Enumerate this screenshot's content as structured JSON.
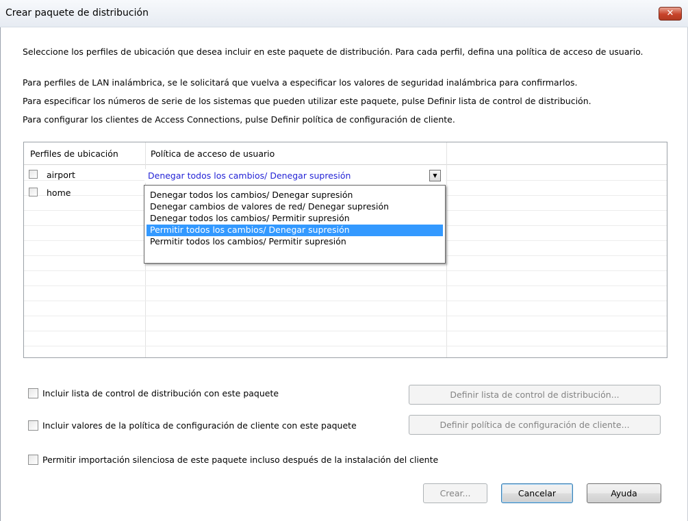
{
  "window": {
    "title": "Crear paquete de distribución",
    "close_glyph": "✕"
  },
  "description": {
    "line1": "Seleccione los perfiles de ubicación que desea incluir en este paquete de distribución. Para cada perfil, defina una política de acceso de usuario.",
    "line2": "Para perfiles de LAN inalámbrica, se le solicitará que vuelva a especificar los valores de seguridad inalámbrica para confirmarlos.",
    "line3": "Para especificar los números de serie de los sistemas que pueden utilizar este paquete, pulse Definir lista de control de distribución.",
    "line4": "Para configurar los clientes de Access Connections, pulse Definir política de configuración de cliente."
  },
  "table": {
    "columns": [
      "Perfiles de ubicación",
      "Política de acceso de usuario"
    ],
    "rows": [
      {
        "name": "airport",
        "checked": false,
        "policy": "Denegar todos los cambios/ Denegar supresión"
      },
      {
        "name": "home",
        "checked": false,
        "policy": ""
      }
    ]
  },
  "policy_dropdown": {
    "selected_value": "Denegar todos los cambios/ Denegar supresión",
    "options": [
      "Denegar todos los cambios/ Denegar supresión",
      "Denegar cambios de valores de red/ Denegar supresión",
      "Denegar todos los cambios/ Permitir supresión",
      "Permitir todos los cambios/ Denegar supresión",
      "Permitir todos los cambios/ Permitir supresión"
    ],
    "highlighted_index": 3
  },
  "options": {
    "include_acl_label": "Incluir lista de control de distribución con este paquete",
    "include_policy_label": "Incluir valores de la política de configuración de cliente con este paquete",
    "silent_import_label": "Permitir importación silenciosa de este paquete incluso después de la instalación del cliente"
  },
  "buttons": {
    "define_acl": "Definir lista de control de distribución...",
    "define_policy": "Definir política de configuración de cliente...",
    "create": "Crear...",
    "cancel": "Cancelar",
    "help": "Ayuda"
  },
  "colors": {
    "selection": "#3399ff",
    "combo_text": "#2323d6"
  }
}
